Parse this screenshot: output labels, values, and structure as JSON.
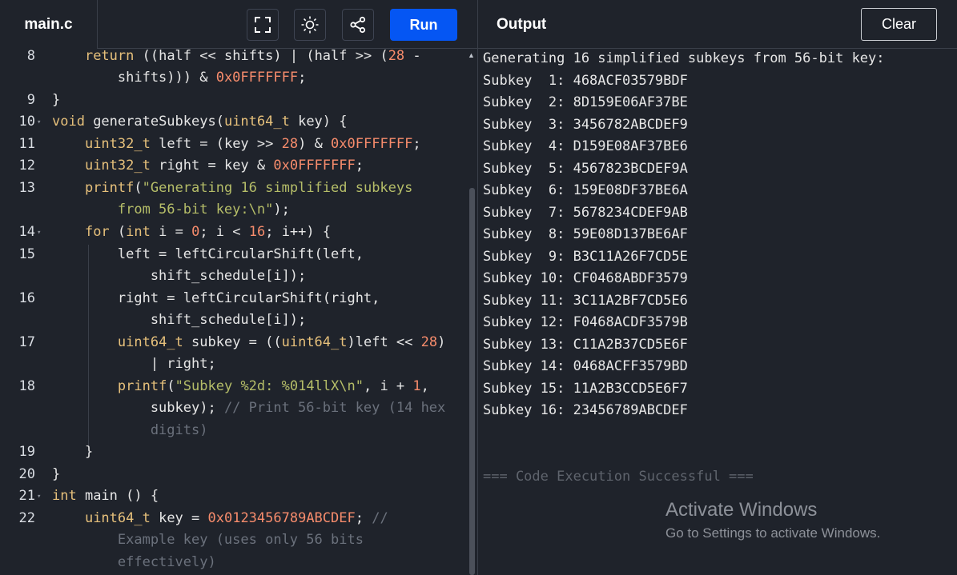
{
  "editor": {
    "filename": "main.c",
    "run_label": "Run",
    "line_numbers": [
      "8",
      "9",
      "10",
      "11",
      "12",
      "13",
      "14",
      "15",
      "16",
      "17",
      "18",
      "19",
      "20",
      "21",
      "22"
    ]
  },
  "output": {
    "title": "Output",
    "clear_label": "Clear",
    "header_line": "Generating 16 simplified subkeys from 56-bit key:",
    "subkeys": [
      "Subkey  1: 468ACF03579BDF",
      "Subkey  2: 8D159E06AF37BE",
      "Subkey  3: 3456782ABCDEF9",
      "Subkey  4: D159E08AF37BE6",
      "Subkey  5: 4567823BCDEF9A",
      "Subkey  6: 159E08DF37BE6A",
      "Subkey  7: 5678234CDEF9AB",
      "Subkey  8: 59E08D137BE6AF",
      "Subkey  9: B3C11A26F7CD5E",
      "Subkey 10: CF0468ABDF3579",
      "Subkey 11: 3C11A2BF7CD5E6",
      "Subkey 12: F0468ACDF3579B",
      "Subkey 13: C11A2B37CD5E6F",
      "Subkey 14: 0468ACFF3579BD",
      "Subkey 15: 11A2B3CCD5E6F7",
      "Subkey 16: 23456789ABCDEF"
    ],
    "status": "=== Code Execution Successful ==="
  },
  "watermark": {
    "title": "Activate Windows",
    "subtitle": "Go to Settings to activate Windows."
  }
}
